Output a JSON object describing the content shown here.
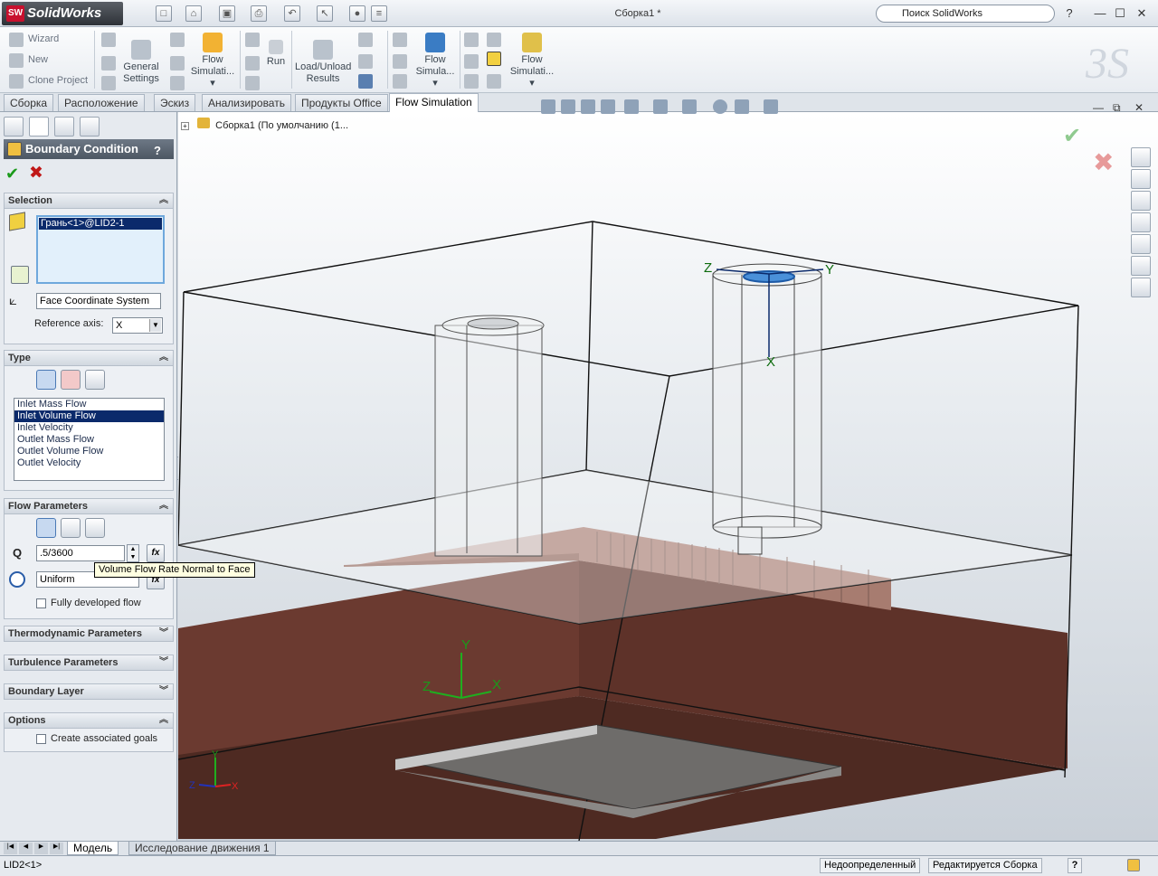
{
  "app": {
    "brand": "SolidWorks",
    "logo_mark": "SW",
    "title": "Сборка1 *",
    "search_placeholder": "Поиск SolidWorks",
    "help_glyph": "?",
    "minimize_glyph": "—",
    "maximize_glyph": "☐",
    "close_glyph": "✕"
  },
  "command_manager": {
    "wizard": "Wizard",
    "new": "New",
    "clone_project": "Clone Project",
    "general_settings_1": "General",
    "general_settings_2": "Settings",
    "flow_sim_1": "Flow",
    "flow_sim_1b": "Simulati...",
    "run": "Run",
    "load_unload_1": "Load/Unload",
    "load_unload_2": "Results",
    "flow_sim_2": "Flow",
    "flow_sim_2b": "Simula...",
    "flow_sim_3": "Flow",
    "flow_sim_3b": "Simulati..."
  },
  "tabs": [
    "Сборка",
    "Расположение",
    "Эскиз",
    "Анализировать",
    "Продукты Office",
    "Flow Simulation"
  ],
  "active_tab_index": 5,
  "property_manager": {
    "title": "Boundary Condition",
    "help": "?",
    "ok": "✔",
    "cancel": "✖",
    "selection": {
      "header": "Selection",
      "chevron": "︽",
      "selected_face": "Грань<1>@LID2-1",
      "coordinate_system": "Face Coordinate System",
      "reference_axis_label": "Reference axis:",
      "reference_axis_value": "X"
    },
    "type": {
      "header": "Type",
      "chevron": "︽",
      "options": [
        "Inlet Mass Flow",
        "Inlet Volume Flow",
        "Inlet Velocity",
        "Outlet Mass Flow",
        "Outlet Volume Flow",
        "Outlet Velocity"
      ],
      "selected_index": 1
    },
    "flow_parameters": {
      "header": "Flow Parameters",
      "chevron": "︽",
      "q_label": "Q",
      "q_value": ".5/3600",
      "profile_value": "Uniform",
      "fx": "fx",
      "fully_developed": "Fully developed flow",
      "fully_developed_checked": false,
      "tooltip": "Volume Flow Rate Normal to Face"
    },
    "thermodynamic": {
      "header": "Thermodynamic Parameters",
      "chevron": "︾"
    },
    "turbulence": {
      "header": "Turbulence Parameters",
      "chevron": "︾"
    },
    "boundary_layer": {
      "header": "Boundary Layer",
      "chevron": "︾"
    },
    "options": {
      "header": "Options",
      "chevron": "︽",
      "create_goals": "Create associated goals",
      "create_goals_checked": false
    }
  },
  "viewport": {
    "tree_root": "Сборка1  (По умолчанию (1...",
    "triad": {
      "x": "X",
      "y": "Y",
      "z": "Z"
    }
  },
  "bottom_tabs": [
    "Модель",
    "Исследование движения 1"
  ],
  "active_bottom_tab": 0,
  "status": {
    "left": "LID2<1>",
    "underdefined": "Недоопределенный",
    "editing": "Редактируется Сборка",
    "help": "?"
  },
  "colors": {
    "accent_selection": "#0b2a6b",
    "brown_solid": "#6b3a30",
    "face_highlight": "#4a90d9"
  }
}
